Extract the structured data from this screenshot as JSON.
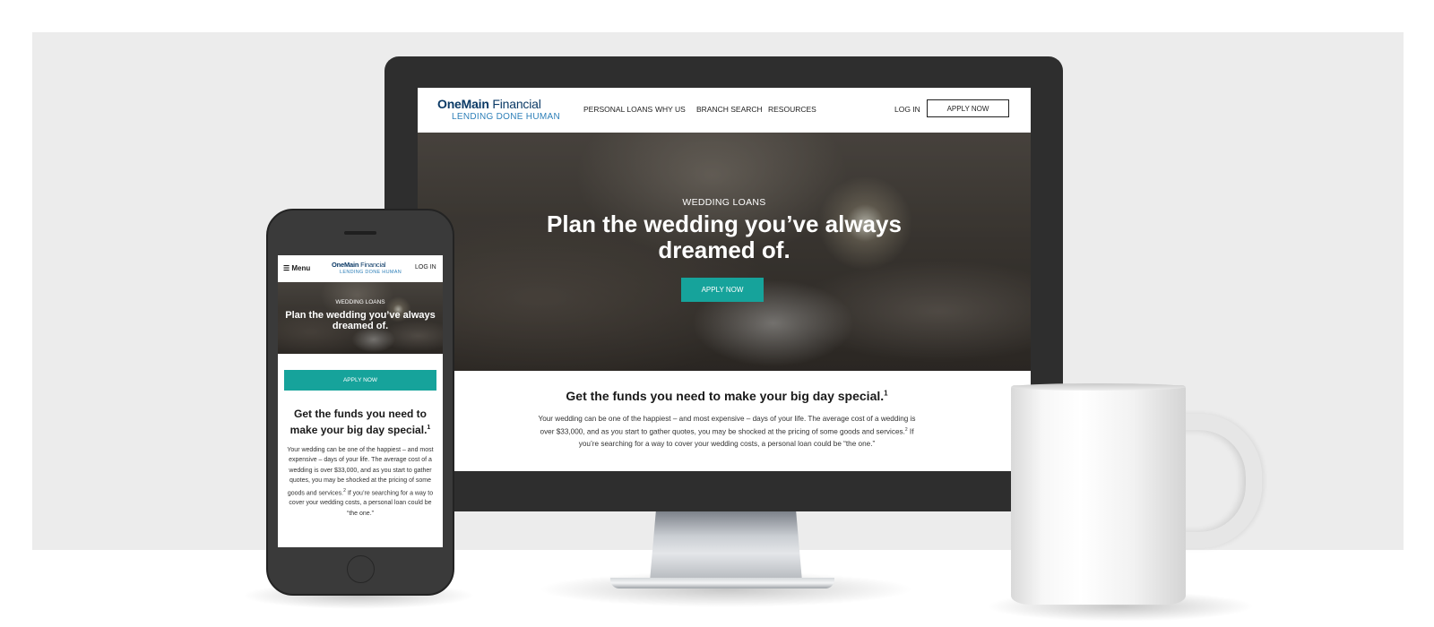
{
  "brand": {
    "name_bold": "OneMain",
    "name_light": " Financial",
    "tagline": "LENDING DONE HUMAN"
  },
  "desktop": {
    "nav": {
      "links": [
        "PERSONAL LOANS",
        "WHY US",
        "BRANCH SEARCH",
        "RESOURCES"
      ],
      "login": "LOG IN",
      "apply": "APPLY NOW"
    },
    "hero": {
      "eyebrow": "WEDDING LOANS",
      "title": "Plan the wedding you’ve always dreamed of.",
      "button": "APPLY NOW"
    },
    "content": {
      "headline": "Get the funds you need to make your big day special.",
      "headline_sup": "1",
      "para_part1": "Your wedding can be one of the happiest – and most expensive – days of your life. The average cost of a wedding is over $33,000, and as you start to gather quotes, you may be shocked at the pricing of some goods and services.",
      "para_sup": "2",
      "para_part2": " If you’re searching for a way to cover your wedding costs, a personal loan could be “the one.”"
    }
  },
  "mobile": {
    "menu": "☰ Menu",
    "login": "LOG IN",
    "hero": {
      "eyebrow": "WEDDING LOANS",
      "title": "Plan the wedding you’ve always dreamed of."
    },
    "apply": "APPLY NOW",
    "headline": "Get the funds you need to make your big day special.",
    "headline_sup": "1",
    "para_part1": "Your wedding can be one of the happiest – and most expensive – days of your life. The average cost of a wedding is over $33,000, and as you start to gather quotes, you may be shocked at the pricing of some goods and services.",
    "para_sup": "2",
    "para_part2": " If you’re searching for a way to cover your wedding costs, a personal loan could be “the one.”"
  },
  "colors": {
    "teal_accent": "#16a39b",
    "brand_navy": "#0b3a66",
    "tagline_blue": "#2d7fb8",
    "device_dark": "#2e2e2e"
  }
}
